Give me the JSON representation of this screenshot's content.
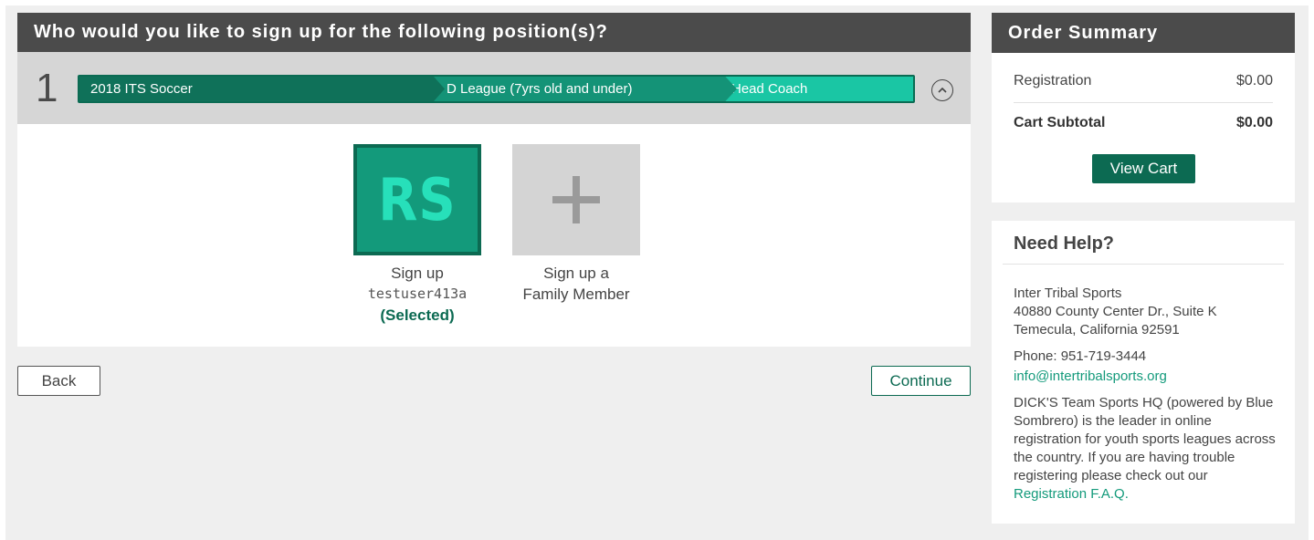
{
  "main": {
    "title": "Who would you like to sign up for the following position(s)?",
    "position": {
      "number": "1",
      "breadcrumbs": [
        "2018 ITS Soccer",
        "D League (7yrs old and under)",
        "Head Coach"
      ]
    },
    "choices": [
      {
        "initials": "RS",
        "line1": "Sign up",
        "line2": "testuser413a",
        "status": "(Selected)"
      },
      {
        "icon": "plus-icon",
        "line1": "Sign up a",
        "line2": "Family Member"
      }
    ],
    "back_label": "Back",
    "continue_label": "Continue"
  },
  "order_summary": {
    "title": "Order Summary",
    "registration_label": "Registration",
    "registration_value": "$0.00",
    "subtotal_label": "Cart Subtotal",
    "subtotal_value": "$0.00",
    "view_cart_label": "View Cart"
  },
  "help": {
    "title": "Need Help?",
    "org_name": "Inter Tribal Sports",
    "address_line1": "40880 County Center Dr., Suite K",
    "address_line2": "Temecula, California 92591",
    "phone": "Phone: 951-719-3444",
    "email": "info@intertribalsports.org",
    "about_text": "DICK'S Team Sports HQ (powered by Blue Sombrero) is the leader in online registration for youth sports leagues across the country. If you are having trouble registering please check out our ",
    "faq_link": "Registration F.A.Q."
  },
  "colors": {
    "header_bg": "#4b4b4b",
    "brand_green": "#0c6a52",
    "accent_teal": "#1ac6a4"
  }
}
